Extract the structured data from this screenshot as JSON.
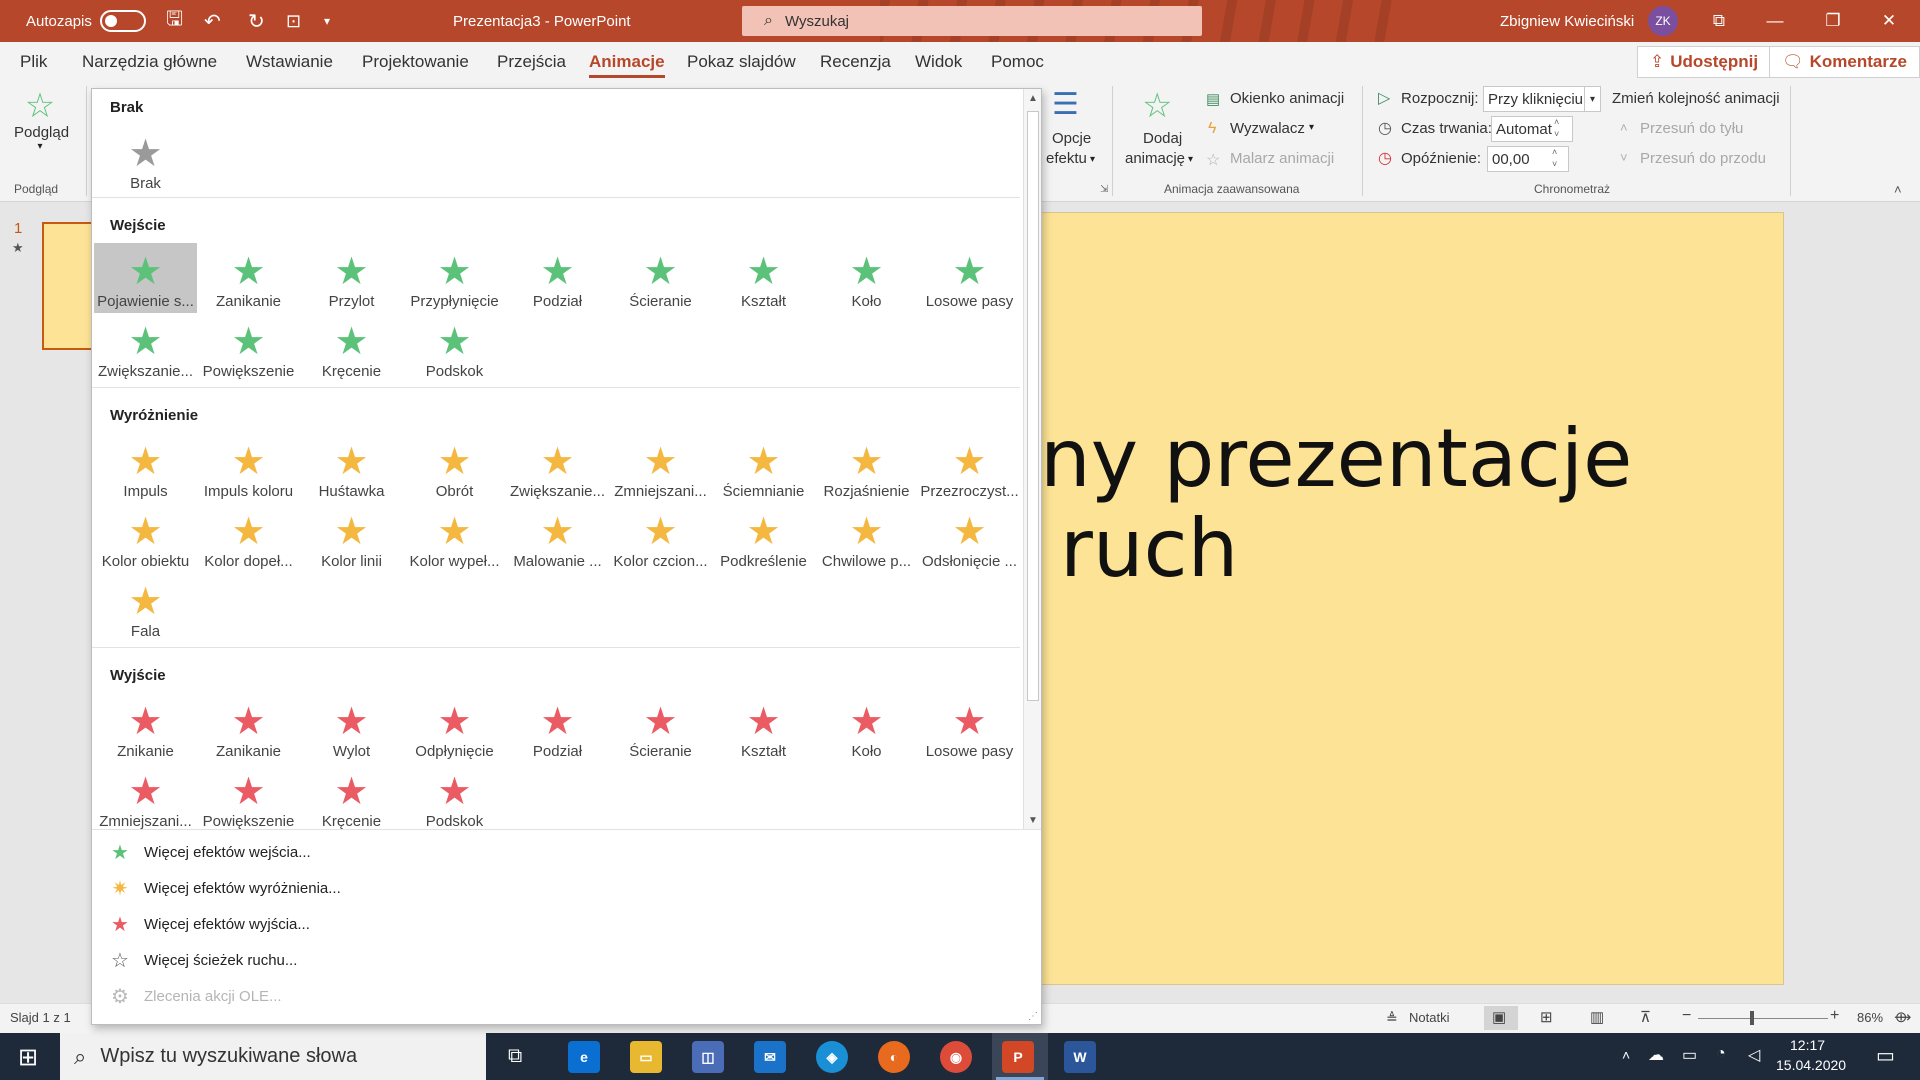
{
  "titlebar": {
    "autosave_label": "Autozapis",
    "doc_title": "Prezentacja3  -  PowerPoint",
    "search_placeholder": "Wyszukaj",
    "user_name": "Zbigniew Kwieciński",
    "user_initials": "ZK",
    "minimize": "—",
    "restore": "❐",
    "close": "✕",
    "ribbon_display": "⧉"
  },
  "tabs": [
    "Plik",
    "Narzędzia główne",
    "Wstawianie",
    "Projektowanie",
    "Przejścia",
    "Animacje",
    "Pokaz slajdów",
    "Recenzja",
    "Widok",
    "Pomoc"
  ],
  "active_tab": "Animacje",
  "header_buttons": {
    "share": "Udostępnij",
    "comments": "Komentarze"
  },
  "ribbon": {
    "preview_label": "Podgląd",
    "preview_group": "Podgląd",
    "effect_options_line1": "Opcje",
    "effect_options_line2": "efektu",
    "add_animation_line1": "Dodaj",
    "add_animation_line2": "animację",
    "animation_pane": "Okienko animacji",
    "trigger": "Wyzwalacz",
    "animation_painter": "Malarz animacji",
    "advanced_group": "Animacja zaawansowana",
    "start_label": "Rozpocznij:",
    "start_value": "Przy kliknięciu",
    "duration_label": "Czas trwania:",
    "duration_value": "Automat",
    "delay_label": "Opóźnienie:",
    "delay_value": "00,00",
    "reorder_label": "Zmień kolejność animacji",
    "move_earlier": "Przesuń do tyłu",
    "move_later": "Przesuń do przodu",
    "timing_group": "Chronometraż"
  },
  "slides_pane": {
    "slide_number": "1",
    "anim_marker": "★"
  },
  "slide": {
    "line1": "ny prezentacje",
    "line2": "ruch"
  },
  "gallery": {
    "sections": [
      {
        "title": "Brak",
        "effects": [
          "Brak"
        ]
      },
      {
        "title": "Wejście",
        "effects": [
          "Pojawienie s...",
          "Zanikanie",
          "Przylot",
          "Przypłynięcie",
          "Podział",
          "Ścieranie",
          "Kształt",
          "Koło",
          "Losowe pasy",
          "Zwiększanie...",
          "Powiększenie",
          "Kręcenie",
          "Podskok"
        ]
      },
      {
        "title": "Wyróżnienie",
        "effects": [
          "Impuls",
          "Impuls koloru",
          "Huśtawka",
          "Obrót",
          "Zwiększanie...",
          "Zmniejszani...",
          "Ściemnianie",
          "Rozjaśnienie",
          "Przezroczyst...",
          "Kolor obiektu",
          "Kolor dopeł...",
          "Kolor linii",
          "Kolor wypeł...",
          "Malowanie ...",
          "Kolor czcion...",
          "Podkreślenie",
          "Chwilowe p...",
          "Odsłonięcie ...",
          "Fala"
        ]
      },
      {
        "title": "Wyjście",
        "effects": [
          "Znikanie",
          "Zanikanie",
          "Wylot",
          "Odpłynięcie",
          "Podział",
          "Ścieranie",
          "Kształt",
          "Koło",
          "Losowe pasy",
          "Zmniejszani...",
          "Powiększenie",
          "Kręcenie",
          "Podskok"
        ]
      }
    ],
    "more": [
      {
        "label": "Więcej efektów wejścia...",
        "icon": "green-star-icon"
      },
      {
        "label": "Więcej efektów wyróżnienia...",
        "icon": "gold-star-icon"
      },
      {
        "label": "Więcej efektów wyjścia...",
        "icon": "red-star-icon"
      },
      {
        "label": "Więcej ścieżek ruchu...",
        "icon": "outline-star-icon"
      },
      {
        "label": "Zlecenia akcji OLE...",
        "icon": "gear-icon",
        "disabled": true
      }
    ]
  },
  "statusbar": {
    "slide_info": "Slajd 1 z 1",
    "notes": "Notatki",
    "zoom": "86%",
    "zoom_minus": "−",
    "zoom_plus": "+"
  },
  "taskbar": {
    "search_placeholder": "Wpisz tu wyszukiwane słowa",
    "time": "12:17",
    "date": "15.04.2020"
  },
  "colors": {
    "accent": "#b7472a",
    "slide_bg": "#fde396",
    "entrance": "#5cc27a",
    "emphasis": "#f4b740",
    "exit": "#ea5b63"
  }
}
